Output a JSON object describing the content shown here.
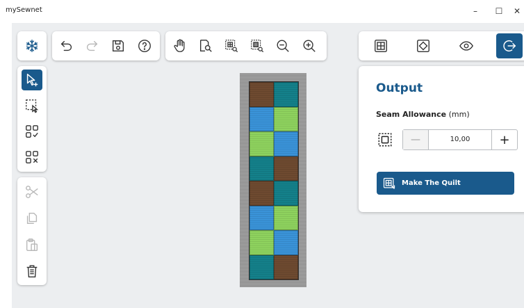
{
  "window": {
    "title": "mySewnet",
    "minimize": "–",
    "maximize": "☐",
    "close": "✕"
  },
  "left_toolbar": {
    "items": [
      {
        "name": "select-add-icon"
      },
      {
        "name": "box-select-icon"
      },
      {
        "name": "select-all-icon"
      },
      {
        "name": "deselect-all-icon"
      },
      {
        "name": "scissors-icon"
      },
      {
        "name": "copy-icon"
      },
      {
        "name": "paste-icon"
      },
      {
        "name": "delete-icon"
      }
    ]
  },
  "top_toolbar": {
    "groups": [
      [
        "snowflake-icon"
      ],
      [
        "undo-icon",
        "redo-icon",
        "save-icon",
        "help-icon"
      ],
      [
        "pan-hand-icon",
        "zoom-page-icon",
        "zoom-block-icon",
        "zoom-selection-icon",
        "zoom-out-icon",
        "zoom-in-icon"
      ]
    ]
  },
  "mode_tabs": [
    {
      "name": "grid-layout-icon"
    },
    {
      "name": "block-design-icon"
    },
    {
      "name": "preview-eye-icon"
    },
    {
      "name": "output-export-icon",
      "active": true
    }
  ],
  "output_panel": {
    "title": "Output",
    "seam_label_bold": "Seam Allowance",
    "seam_label_unit": " (mm)",
    "seam_value": "10,00",
    "minus": "—",
    "plus": "+",
    "make_quilt_label": "Make The Quilt"
  },
  "quilt": {
    "colors": {
      "brown": "#6e4a30",
      "blue": "#3a93d8",
      "green": "#8ed25e",
      "teal": "#14808a"
    },
    "rows": [
      [
        "brown",
        "teal"
      ],
      [
        "blue",
        "green"
      ],
      [
        "green",
        "blue"
      ],
      [
        "teal",
        "brown"
      ],
      [
        "brown",
        "teal"
      ],
      [
        "blue",
        "green"
      ],
      [
        "green",
        "blue"
      ],
      [
        "teal",
        "brown"
      ]
    ]
  },
  "accent_color": "#1a5a8c"
}
